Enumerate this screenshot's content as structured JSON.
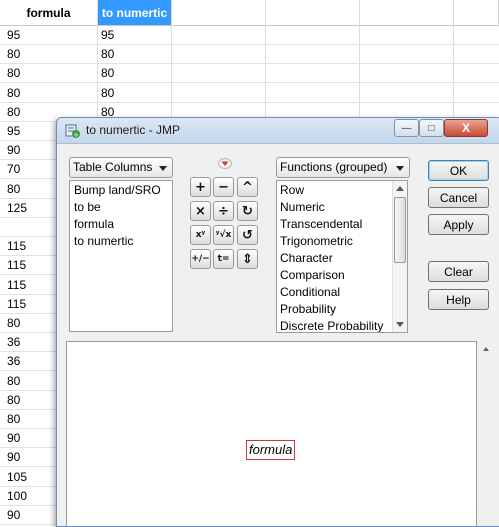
{
  "spreadsheet": {
    "headers": [
      "formula",
      "to numertic"
    ],
    "selected_header_index": 1,
    "rows": [
      [
        "95",
        "95"
      ],
      [
        "80",
        "80"
      ],
      [
        "80",
        "80"
      ],
      [
        "80",
        "80"
      ],
      [
        "80",
        "80"
      ],
      [
        "95",
        ""
      ],
      [
        "90",
        ""
      ],
      [
        "70",
        ""
      ],
      [
        "80",
        ""
      ],
      [
        "125",
        ""
      ],
      [
        "",
        ""
      ],
      [
        "115",
        ""
      ],
      [
        "115",
        ""
      ],
      [
        "115",
        ""
      ],
      [
        "115",
        ""
      ],
      [
        "80",
        ""
      ],
      [
        "36",
        ""
      ],
      [
        "36",
        ""
      ],
      [
        "80",
        ""
      ],
      [
        "80",
        ""
      ],
      [
        "80",
        ""
      ],
      [
        "90",
        ""
      ],
      [
        "90",
        ""
      ],
      [
        "105",
        ""
      ],
      [
        "100",
        ""
      ],
      [
        "90",
        ""
      ]
    ]
  },
  "dialog": {
    "title": "to numertic - JMP",
    "window_buttons": {
      "minimize": "—",
      "maximize": "□",
      "close": "X"
    },
    "table_columns_label": "Table Columns",
    "columns": [
      "Bump land/SRO",
      "to be",
      "formula",
      "to numertic"
    ],
    "functions_label": "Functions (grouped)",
    "functions": [
      "Row",
      "Numeric",
      "Transcendental",
      "Trigonometric",
      "Character",
      "Comparison",
      "Conditional",
      "Probability",
      "Discrete Probability"
    ],
    "keypad": [
      [
        "+",
        "−",
        "^"
      ],
      [
        "×",
        "÷",
        "↻"
      ],
      [
        "xʸ",
        "ʸ√x",
        "↺"
      ],
      [
        "+/−",
        "t=",
        "⇕"
      ]
    ],
    "buttons": {
      "ok": "OK",
      "cancel": "Cancel",
      "apply": "Apply",
      "clear": "Clear",
      "help": "Help"
    },
    "formula_term": "formula"
  },
  "colors": {
    "selected_header": "#3399ff",
    "titlebar": "#c4d6ea",
    "close_button": "#c94a33",
    "formula_border": "#c23a3a",
    "expand_arrow": "#d23a3a"
  }
}
